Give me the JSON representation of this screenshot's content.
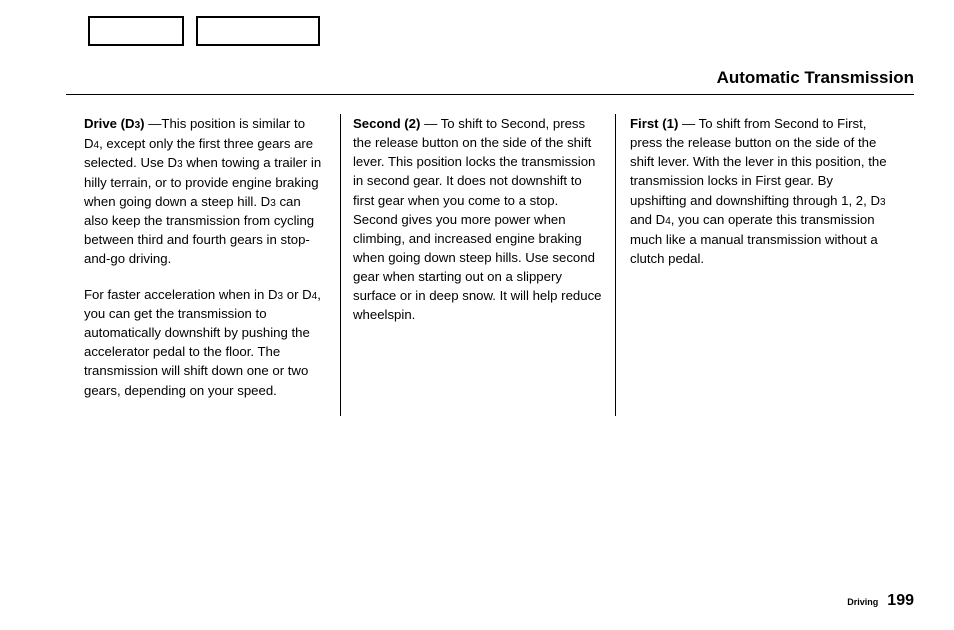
{
  "header": {
    "title": "Automatic Transmission"
  },
  "columns": {
    "col1": {
      "p1": {
        "lead": "Drive (D",
        "sub1": "3",
        "after_sub1": ")",
        "seg2": " —This position is similar to D",
        "sub2": "4",
        "seg3": ", except only the first three gears are selected. Use D",
        "sub3": "3",
        "seg4": " when towing a trailer in hilly terrain, or to provide engine braking when going down a steep hill. D",
        "sub4": "3",
        "seg5": " can also keep the transmission from cycling between third and fourth gears in stop-and-go driving."
      },
      "p2": {
        "seg1": "For faster acceleration when in D",
        "sub1": "3",
        "seg2": " or D",
        "sub2": "4",
        "seg3": ", you can get the transmission to automatically downshift by pushing the accelerator pedal to the floor. The transmission will shift down one or two gears, depending on your speed."
      }
    },
    "col2": {
      "p1": {
        "lead": "Second (2)",
        "body": " — To shift to Second, press the release button on the side of the shift lever. This position locks the transmission in second gear. It does not downshift to first gear when you come to a stop. Second gives you more power when climbing, and increased engine braking when going down steep hills. Use second gear when starting out on a slippery surface or in deep snow. It will help reduce wheelspin."
      }
    },
    "col3": {
      "p1": {
        "lead": "First (1)",
        "seg1": " — To shift from Second to First, press the release button on the side of the shift lever. With the lever in this position, the transmission locks in First gear. By upshifting and downshifting through 1, 2, D",
        "sub1": "3",
        "seg2": " and D",
        "sub2": "4",
        "seg3": ", you can operate this transmission much like a manual transmission without a clutch pedal."
      }
    }
  },
  "footer": {
    "section": "Driving",
    "page": "199"
  }
}
